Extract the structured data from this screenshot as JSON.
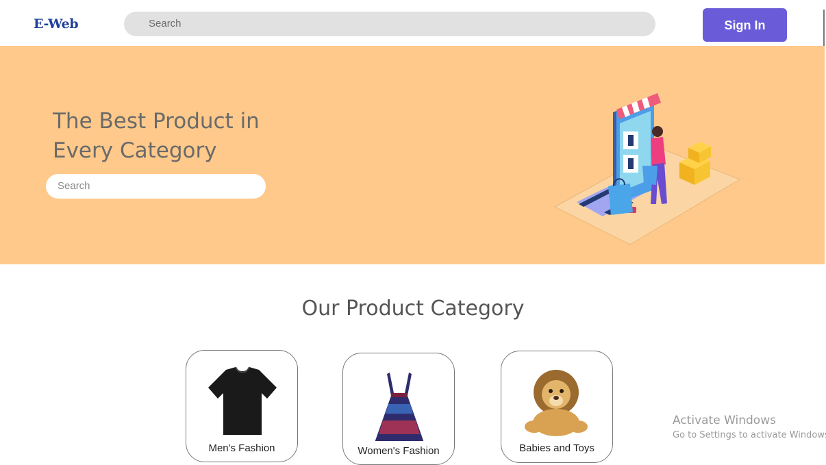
{
  "header": {
    "logo": "E-Web",
    "search_placeholder": "Search",
    "sign_in_label": "Sign In"
  },
  "hero": {
    "title_line1": "The Best Product in",
    "title_line2": "Every Category",
    "search_placeholder": "Search"
  },
  "categories": {
    "heading": "Our Product Category",
    "items": [
      {
        "label": "Men's Fashion",
        "icon": "tshirt-icon"
      },
      {
        "label": "Women's Fashion",
        "icon": "dress-icon"
      },
      {
        "label": "Babies and Toys",
        "icon": "lion-toy-icon"
      }
    ]
  },
  "watermark": {
    "line1": "Activate Windows",
    "line2": "Go to Settings to activate Windows."
  },
  "colors": {
    "brand": "#1f3f9a",
    "accent": "#6a5cd8",
    "hero_bg": "#fec98a"
  }
}
